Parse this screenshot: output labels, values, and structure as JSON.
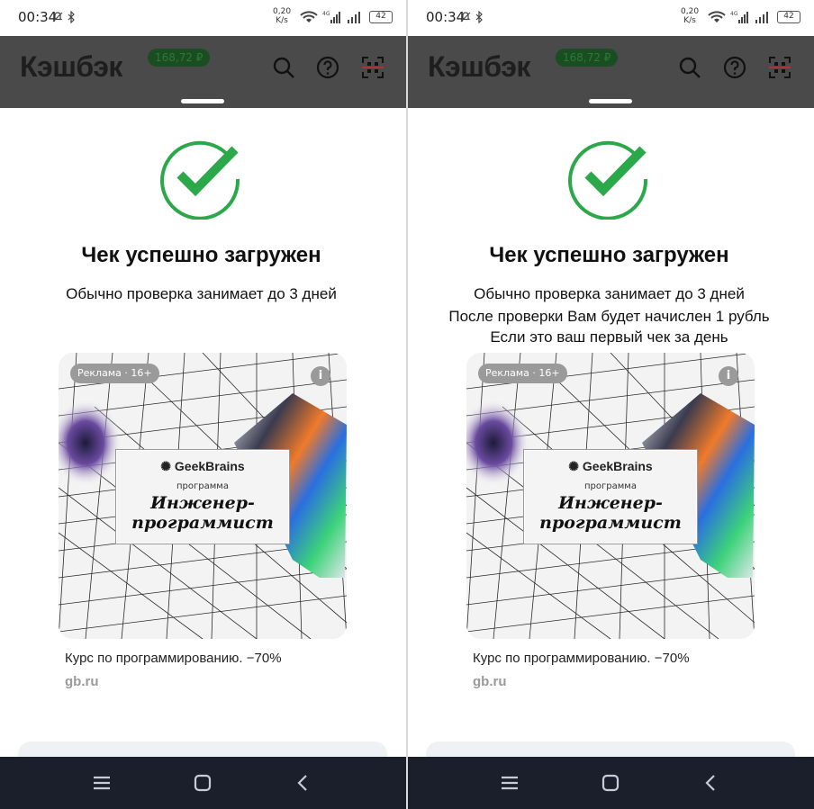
{
  "left_screen": {
    "status": {
      "time": "00:34",
      "speed_value": "0,20",
      "speed_unit": "K/s",
      "battery": "42"
    },
    "app": {
      "title": "Кэшбэк",
      "balance": "168,72 ₽"
    },
    "success": {
      "heading": "Чек успешно загружен",
      "lines": [
        "Обычно проверка занимает до 3 дней"
      ]
    },
    "ad": {
      "badge": "Реклама · 16+",
      "info_icon": "i",
      "brand": "GeekBrains",
      "program_label": "программа",
      "course_line1": "Инженер-",
      "course_line2": "программист",
      "text": "Курс по программированию. −70%",
      "url": "gb.ru"
    }
  },
  "right_screen": {
    "status": {
      "time": "00:34",
      "speed_value": "0,20",
      "speed_unit": "K/s",
      "battery": "42"
    },
    "app": {
      "title": "Кэшбэк",
      "balance": "168,72 ₽"
    },
    "success": {
      "heading": "Чек успешно загружен",
      "lines": [
        "Обычно проверка занимает до 3 дней",
        "После проверки Вам будет начислен 1 рубль",
        "Если это ваш первый чек за день"
      ]
    },
    "ad": {
      "badge": "Реклама · 16+",
      "info_icon": "i",
      "brand": "GeekBrains",
      "program_label": "программа",
      "course_line1": "Инженер-",
      "course_line2": "программист",
      "text": "Курс по программированию. −70%",
      "url": "gb.ru"
    }
  },
  "colors": {
    "accent_green": "#2ba84a",
    "appbar_dim": "#4a4a4a",
    "navbar": "#1a1f2b"
  }
}
